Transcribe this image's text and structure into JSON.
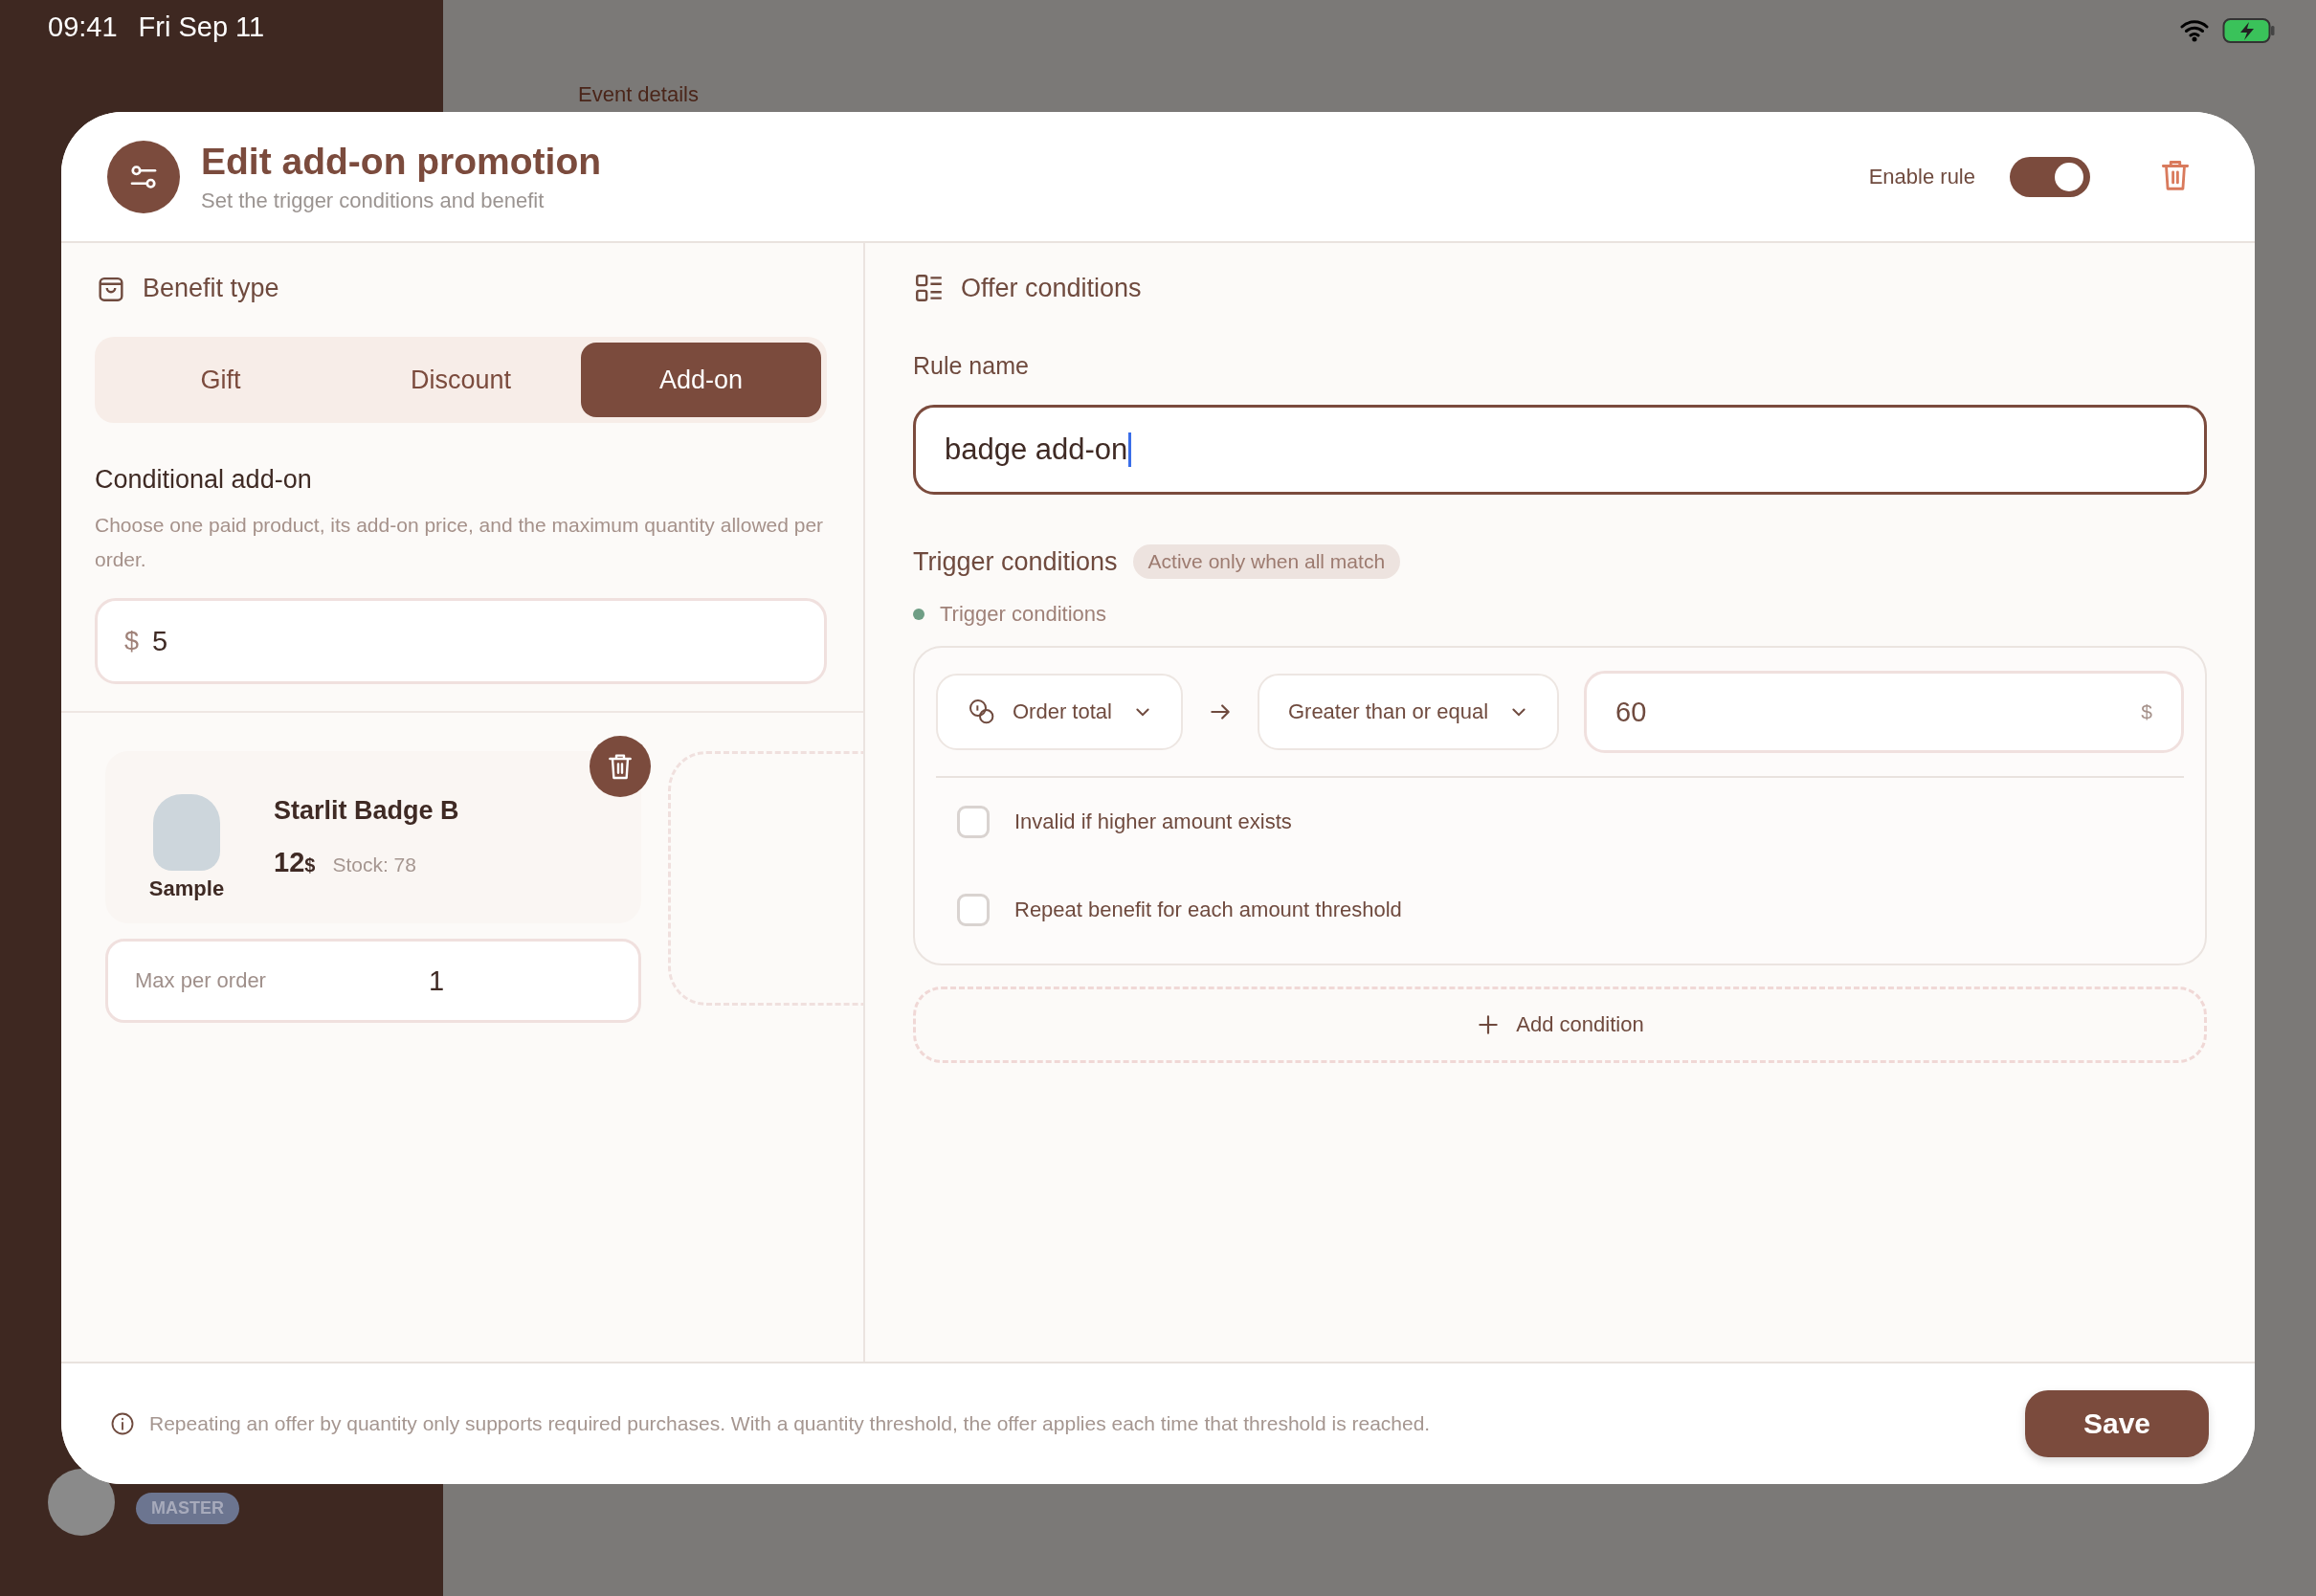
{
  "status_bar": {
    "time": "09:41",
    "date": "Fri Sep 11"
  },
  "background": {
    "breadcrumb": "Event details",
    "badge": "MASTER"
  },
  "dialog": {
    "title": "Edit add-on promotion",
    "subtitle": "Set the trigger conditions and benefit",
    "enable_label": "Enable rule",
    "enabled": true
  },
  "benefit": {
    "heading": "Benefit type",
    "tabs": [
      {
        "label": "Gift",
        "selected": false
      },
      {
        "label": "Discount",
        "selected": false
      },
      {
        "label": "Add-on",
        "selected": true
      }
    ],
    "section_title": "Conditional add-on",
    "description": "Choose one paid product, its add-on price, and the maximum quantity allowed per order.",
    "price": {
      "prefix": "$",
      "value": "5"
    },
    "product": {
      "image_caption": "Sample",
      "name": "Starlit Badge B",
      "amount": "12",
      "currency": "$",
      "stock": "Stock: 78",
      "max_label": "Max per order",
      "max_value": "1"
    }
  },
  "conditions": {
    "heading": "Offer conditions",
    "rule_name_label": "Rule name",
    "rule_name": "badge add-on",
    "trigger_title": "Trigger conditions",
    "trigger_badge": "Active only when all match",
    "group_label": "Trigger conditions",
    "rows": [
      {
        "field": "Order total",
        "operator": "Greater than or equal",
        "value": "60",
        "unit": "$"
      }
    ],
    "options": [
      {
        "label": "Invalid if higher amount exists",
        "checked": false
      },
      {
        "label": "Repeat benefit for each amount threshold",
        "checked": false
      }
    ],
    "add_label": "Add condition"
  },
  "footer": {
    "note": "Repeating an offer by quantity only supports required purchases. With a quantity threshold, the offer applies each time that threshold is reached.",
    "save": "Save"
  }
}
